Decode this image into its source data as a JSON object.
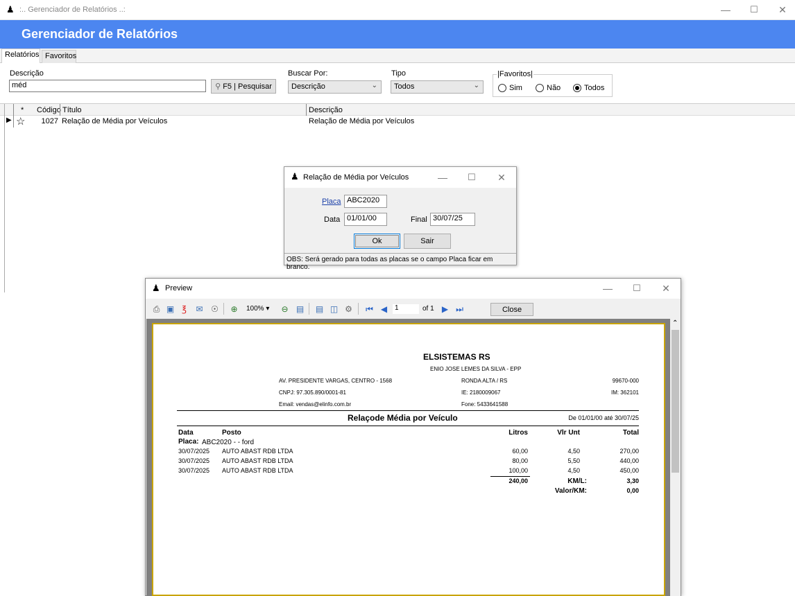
{
  "main": {
    "window_title": ":.. Gerenciador de Relatórios ..:",
    "banner_title": "Gerenciador de Relatórios",
    "tabs": [
      "Relatórios",
      "Favoritos"
    ],
    "filters": {
      "descricao_label": "Descrição",
      "descricao_value": "méd",
      "search_button": "F5 | Pesquisar",
      "buscar_label": "Buscar Por:",
      "buscar_value": "Descrição",
      "tipo_label": "Tipo",
      "tipo_value": "Todos",
      "favoritos_label": "Favoritos",
      "favoritos_options": [
        "Sim",
        "Não",
        "Todos"
      ],
      "favoritos_selected": "Todos"
    },
    "grid": {
      "columns": [
        "*",
        "Código",
        "Título",
        "Descrição"
      ],
      "rows": [
        {
          "codigo": "1027",
          "titulo": "Relação de Média por Veículos",
          "descricao": "Relação de Média por Veículos"
        }
      ]
    }
  },
  "dialog": {
    "title": "Relação de Média por Veículos",
    "placa_label": "Placa",
    "placa_value": "ABC2020",
    "data_label": "Data",
    "data_value": "01/01/00",
    "final_label": "Final",
    "final_value": "30/07/25",
    "ok_button": "Ok",
    "sair_button": "Sair",
    "obs": "OBS: Será gerado para todas as placas se o campo Placa ficar em branco."
  },
  "preview": {
    "title": "Preview",
    "zoom": "100%",
    "page_current": "1",
    "page_total": "of 1",
    "close_button": "Close",
    "report": {
      "company": "ELSISTEMAS RS",
      "owner": "ENIO JOSE LEMES DA SILVA - EPP",
      "address": "AV. PRESIDENTE VARGAS, CENTRO - 1568",
      "city": "RONDA ALTA / RS",
      "cep": "99670-000",
      "cnpj": "CNPJ: 97.305.890/0001-81",
      "ie": "IE: 2180009067",
      "im": "IM: 362101",
      "email": "Email: vendas@elinfo.com.br",
      "fone": "Fone: 5433641588",
      "report_title": "Relaçode Média por Veículo",
      "period": "De 01/01/00 até 30/07/25",
      "headers": {
        "data": "Data",
        "posto": "Posto",
        "litros": "Litros",
        "vlr_unt": "Vlr Unt",
        "total": "Total"
      },
      "placa_label": "Placa:",
      "placa_value": "ABC2020 -  - ford",
      "rows": [
        {
          "data": "30/07/2025",
          "posto": "AUTO ABAST RDB LTDA",
          "litros": "60,00",
          "vlr_unt": "4,50",
          "total": "270,00"
        },
        {
          "data": "30/07/2025",
          "posto": "AUTO ABAST RDB LTDA",
          "litros": "80,00",
          "vlr_unt": "5,50",
          "total": "440,00"
        },
        {
          "data": "30/07/2025",
          "posto": "AUTO ABAST RDB LTDA",
          "litros": "100,00",
          "vlr_unt": "4,50",
          "total": "450,00"
        }
      ],
      "total_litros": "240,00",
      "kml_label": "KM/L:",
      "kml_value": "3,30",
      "valorkm_label": "Valor/KM:",
      "valorkm_value": "0,00"
    }
  }
}
